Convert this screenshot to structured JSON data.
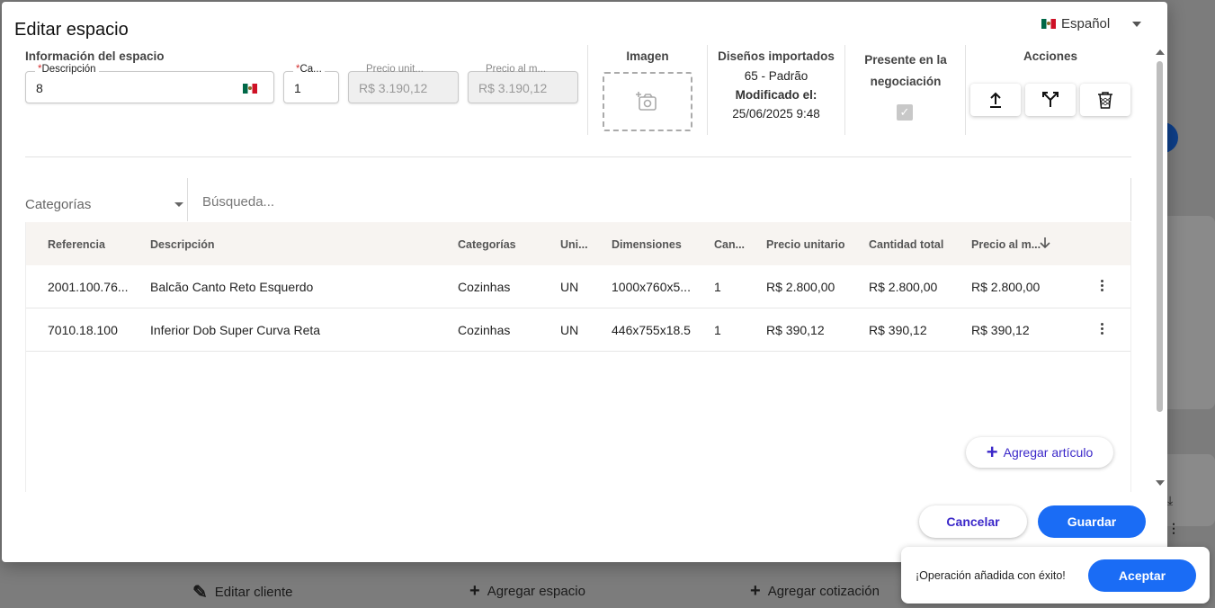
{
  "modal": {
    "title": "Editar espacio",
    "language": "Español"
  },
  "space_info": {
    "section_label": "Información del espacio",
    "description_label": "Descripción",
    "description_value": "8",
    "quantity_label": "Ca...",
    "quantity_value": "1",
    "unit_price_label": "Precio unit...",
    "unit_price_value": "R$ 3.190,12",
    "total_price_label": "Precio al m...",
    "total_price_value": "R$ 3.190,12"
  },
  "image": {
    "label": "Imagen"
  },
  "imported_designs": {
    "label": "Diseños importados",
    "value": "65 - Padrão",
    "modified_label": "Modificado el:",
    "modified_value": "25/06/2025 9:48"
  },
  "negotiation": {
    "label_line1": "Presente en la",
    "label_line2": "negociación",
    "checked": true
  },
  "actions": {
    "label": "Acciones",
    "buttons": [
      "upload-icon",
      "merge-icon",
      "trash-icon"
    ]
  },
  "filters": {
    "category_placeholder": "Categorías",
    "search_placeholder": "Búsqueda..."
  },
  "table": {
    "headers": [
      "Referencia",
      "Descripción",
      "Categorías",
      "Uni...",
      "Dimensiones",
      "Can...",
      "Precio unitario",
      "Cantidad total",
      "Precio al m..."
    ],
    "rows": [
      [
        "2001.100.76...",
        "Balcão Canto Reto Esquerdo",
        "Cozinhas",
        "UN",
        "1000x760x5...",
        "1",
        "R$ 2.800,00",
        "R$ 2.800,00",
        "R$ 2.800,00"
      ],
      [
        "7010.18.100",
        "Inferior Dob Super Curva Reta",
        "Cozinhas",
        "UN",
        "446x755x18.5",
        "1",
        "R$ 390,12",
        "R$ 390,12",
        "R$ 390,12"
      ]
    ],
    "add_label": "Agregar artículo"
  },
  "footer": {
    "cancel_label": "Cancelar",
    "save_label": "Guardar"
  },
  "toast": {
    "message": "¡Operación añadida con éxito!",
    "accept_label": "Aceptar"
  },
  "background": {
    "edit_client": "Editar cliente",
    "add_space": "Agregar espacio",
    "add_quote": "Agregar cotización"
  },
  "colors": {
    "primary": "#1a6cf5",
    "accent_text": "#3b28c9"
  }
}
